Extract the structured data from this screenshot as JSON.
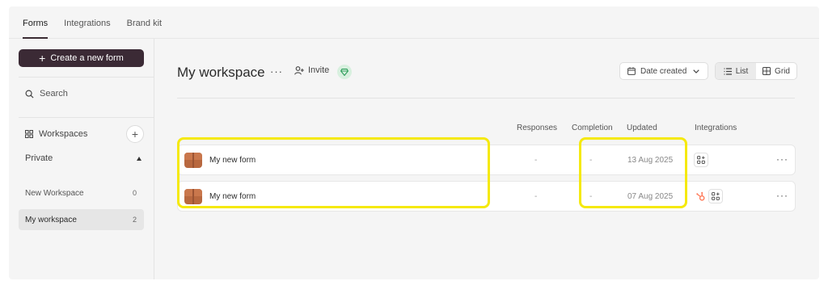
{
  "topnav": {
    "tabs": [
      {
        "label": "Forms",
        "active": true
      },
      {
        "label": "Integrations"
      },
      {
        "label": "Brand kit"
      }
    ]
  },
  "sidebar": {
    "create_label": "Create a new form",
    "search_label": "Search",
    "workspaces_label": "Workspaces",
    "private_label": "Private",
    "items": [
      {
        "label": "New Workspace",
        "count": "0"
      },
      {
        "label": "My workspace",
        "count": "2",
        "selected": true
      }
    ]
  },
  "header": {
    "title": "My workspace",
    "invite_label": "Invite",
    "sort_label": "Date created",
    "view_options": [
      {
        "label": "List",
        "active": true
      },
      {
        "label": "Grid"
      }
    ]
  },
  "table": {
    "columns": {
      "responses": "Responses",
      "completion": "Completion",
      "updated": "Updated",
      "integrations": "Integrations"
    },
    "rows": [
      {
        "name": "My new form",
        "responses": "-",
        "completion": "-",
        "updated": "13 Aug 2025",
        "integrations": [
          "apps-icon"
        ]
      },
      {
        "name": "My new form",
        "responses": "-",
        "completion": "-",
        "updated": "07 Aug 2025",
        "integrations": [
          "hubspot-icon",
          "apps-icon"
        ]
      }
    ]
  },
  "colors": {
    "accent": "#3b2a35",
    "highlight": "#f5e90c",
    "hubspot": "#ff7a59",
    "gem": "#2e9e5b"
  }
}
